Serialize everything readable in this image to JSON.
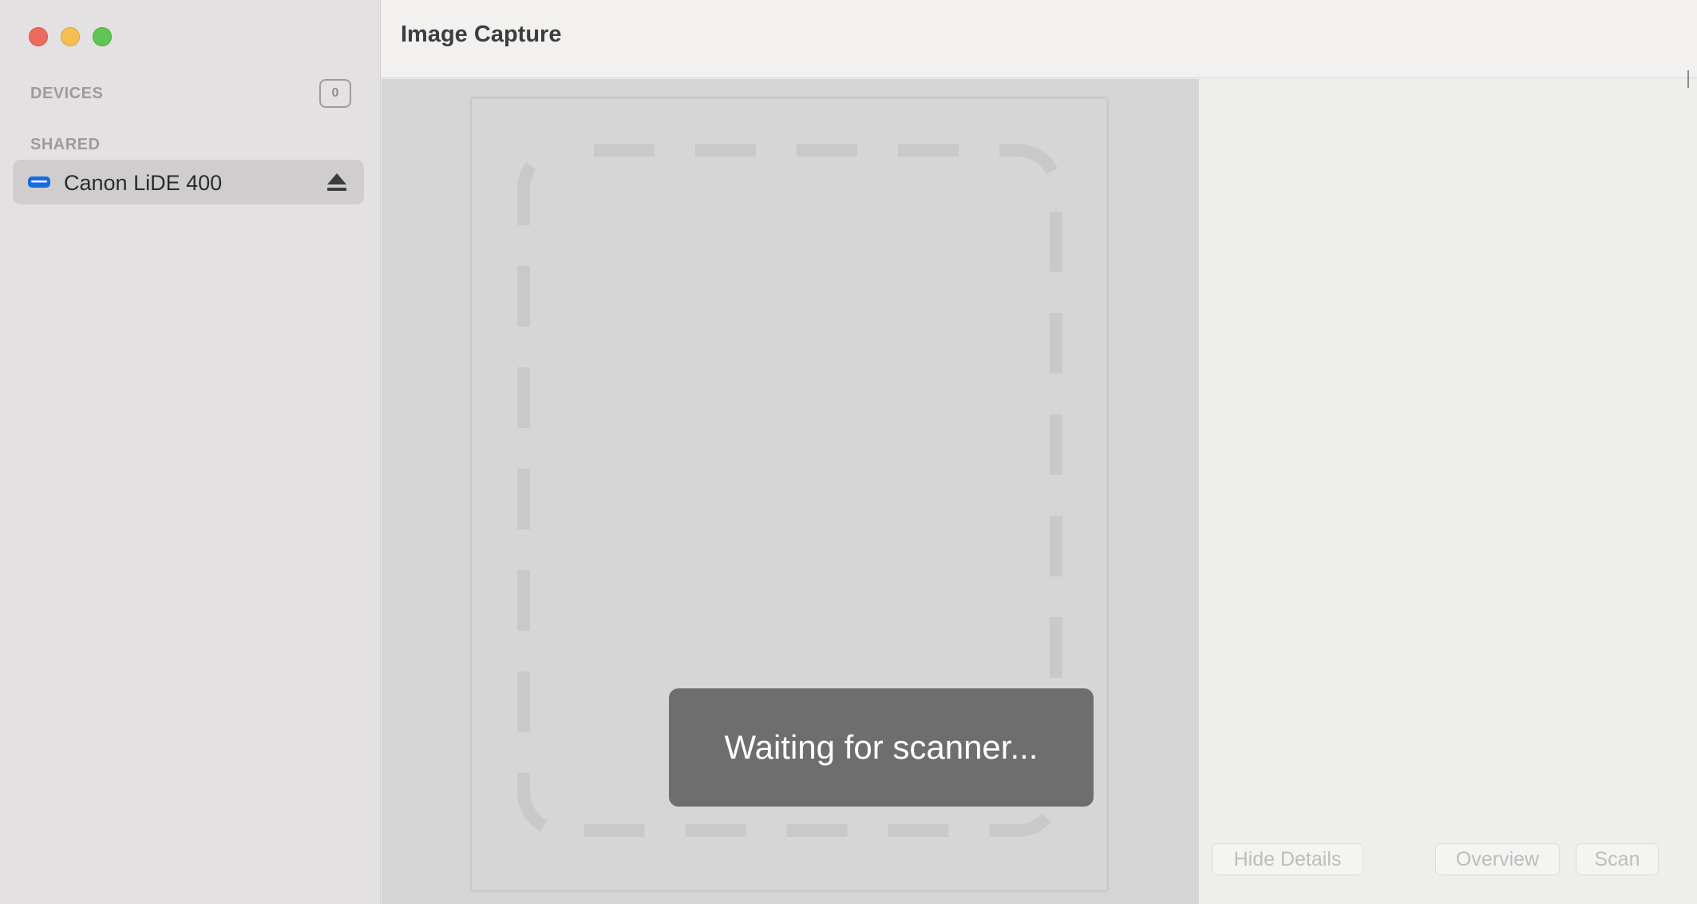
{
  "window": {
    "title": "Image Capture"
  },
  "sidebar": {
    "devices_label": "DEVICES",
    "devices_count": "0",
    "shared_label": "SHARED",
    "items": [
      {
        "label": "Canon LiDE 400",
        "icon": "scanner-icon",
        "action_icon": "eject-icon"
      }
    ]
  },
  "preview": {
    "status_text": "Waiting for scanner..."
  },
  "footer": {
    "hide_details_label": "Hide Details",
    "overview_label": "Overview",
    "scan_label": "Scan"
  },
  "colors": {
    "accent_blue": "#1a6be0",
    "close": "#ed6a5e",
    "minimize": "#f5bf4f",
    "zoom": "#61c554"
  }
}
